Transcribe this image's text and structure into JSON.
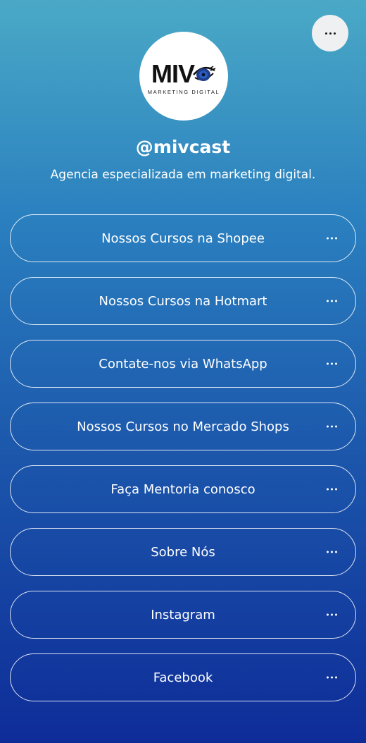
{
  "profile": {
    "logo_text": "MIV",
    "logo_subtitle": "MARKETING DIGITAL",
    "handle": "@mivcast",
    "bio": "Agencia especializada em marketing digital."
  },
  "header": {
    "menu_icon": "more-horizontal-icon"
  },
  "links": [
    {
      "label": "Nossos Cursos na Shopee"
    },
    {
      "label": "Nossos Cursos na Hotmart"
    },
    {
      "label": "Contate-nos via WhatsApp"
    },
    {
      "label": "Nossos Cursos no Mercado Shops"
    },
    {
      "label": "Faça Mentoria conosco"
    },
    {
      "label": "Sobre Nós"
    },
    {
      "label": "Instagram"
    },
    {
      "label": "Facebook"
    }
  ],
  "colors": {
    "gradient_top": "#4aa9c6",
    "gradient_bottom": "#0e2c98",
    "button_border": "#ffffff",
    "menu_button_bg": "#eef0f2"
  }
}
